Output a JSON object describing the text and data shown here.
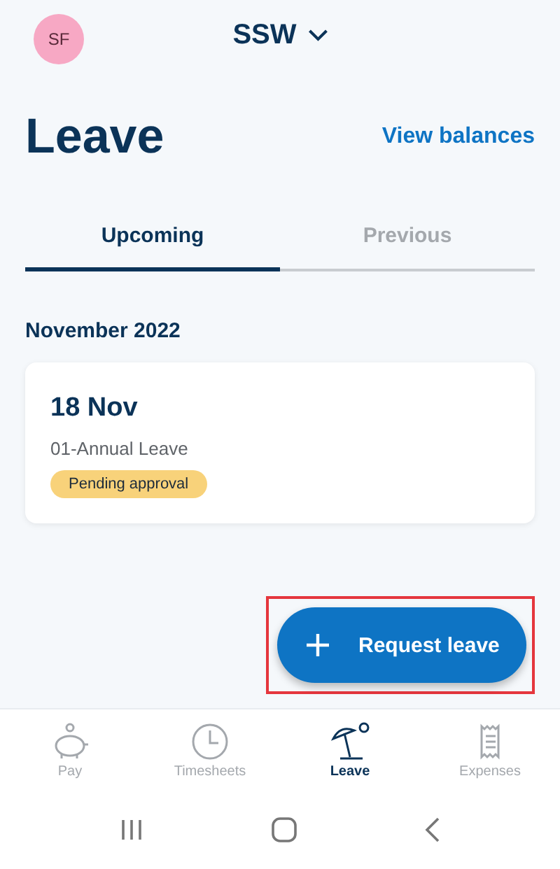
{
  "header": {
    "avatar": "SF",
    "org": "SSW"
  },
  "title": "Leave",
  "balances_link": "View balances",
  "tabs": [
    {
      "label": "Upcoming",
      "selected": true
    },
    {
      "label": "Previous",
      "selected": false
    }
  ],
  "groups": [
    {
      "month": "November 2022",
      "entries": [
        {
          "date": "18 Nov",
          "type": "01-Annual Leave",
          "status": "Pending approval"
        }
      ]
    }
  ],
  "fab": {
    "label": "Request leave",
    "highlighted": true
  },
  "nav": [
    {
      "kind": "pay",
      "label": "Pay",
      "selected": false
    },
    {
      "kind": "timesheets",
      "label": "Timesheets",
      "selected": false
    },
    {
      "kind": "leave",
      "label": "Leave",
      "selected": true
    },
    {
      "kind": "expenses",
      "label": "Expenses",
      "selected": false
    }
  ]
}
